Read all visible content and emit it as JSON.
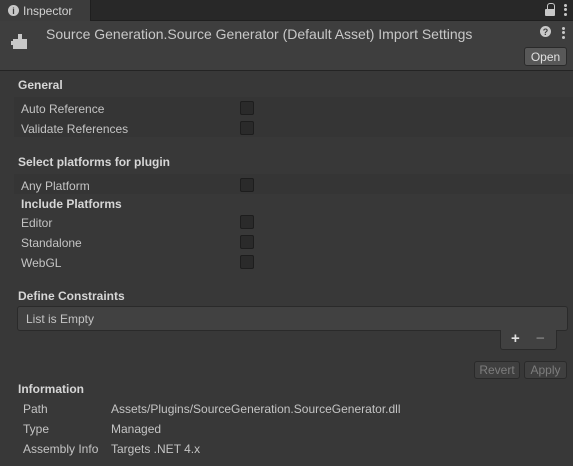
{
  "tab": {
    "title": "Inspector"
  },
  "header": {
    "title": "Source Generation.Source Generator (Default Asset) Import Settings",
    "open_label": "Open"
  },
  "general": {
    "title": "General",
    "rows": [
      {
        "label": "Auto Reference",
        "checked": false
      },
      {
        "label": "Validate References",
        "checked": false
      }
    ]
  },
  "platforms": {
    "title": "Select platforms for plugin",
    "any_platform": {
      "label": "Any Platform",
      "checked": false
    },
    "include_title": "Include Platforms",
    "rows": [
      {
        "label": "Editor",
        "checked": false
      },
      {
        "label": "Standalone",
        "checked": false
      },
      {
        "label": "WebGL",
        "checked": false
      }
    ]
  },
  "constraints": {
    "title": "Define Constraints",
    "empty_text": "List is Empty",
    "add_label": "+",
    "remove_label": "−"
  },
  "actions": {
    "revert": "Revert",
    "apply": "Apply"
  },
  "information": {
    "title": "Information",
    "rows": [
      {
        "label": "Path",
        "value": "Assets/Plugins/SourceGeneration.SourceGenerator.dll"
      },
      {
        "label": "Type",
        "value": "Managed"
      },
      {
        "label": "Assembly Info",
        "value": "Targets .NET 4.x"
      }
    ]
  }
}
